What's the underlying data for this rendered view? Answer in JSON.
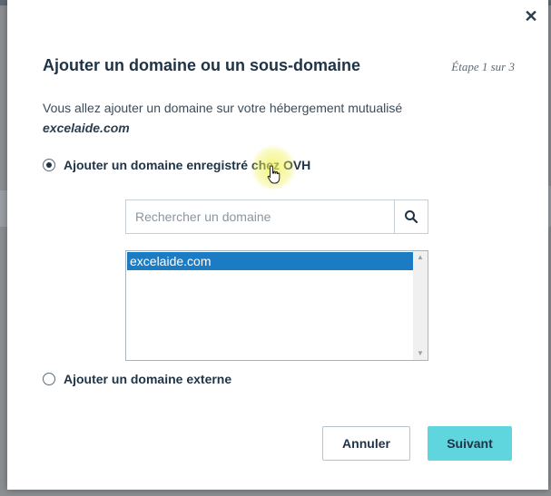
{
  "modal": {
    "close_symbol": "✕",
    "title": "Ajouter un domaine ou un sous-domaine",
    "step": "Étape 1 sur 3",
    "intro": "Vous allez ajouter un domaine sur votre hébergement mutualisé",
    "hosting_domain": "excelaide.com"
  },
  "options": {
    "ovh_label": "Ajouter un domaine enregistré chez OVH",
    "ovh_checked": true,
    "external_label": "Ajouter un domaine externe",
    "external_checked": false
  },
  "search": {
    "placeholder": "Rechercher un domaine",
    "value": "",
    "icon": "search-icon"
  },
  "domain_list": {
    "items": [
      "excelaide.com"
    ],
    "selected": "excelaide.com"
  },
  "buttons": {
    "cancel": "Annuler",
    "next": "Suivant"
  },
  "colors": {
    "accent": "#5fd6de",
    "selection": "#1b7cc4",
    "title": "#1f3347"
  }
}
